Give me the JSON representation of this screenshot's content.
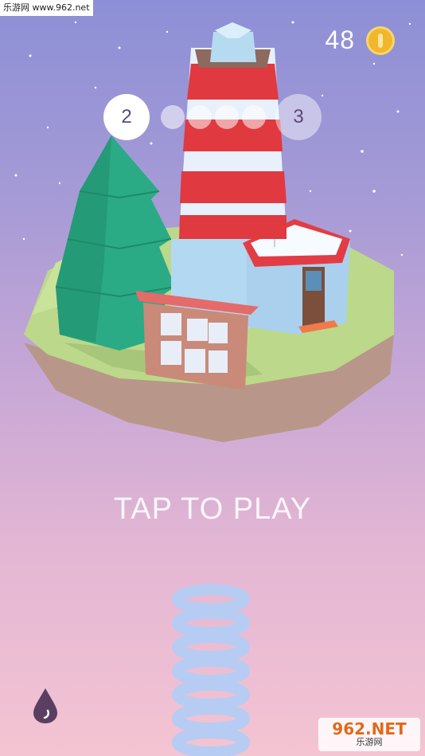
{
  "watermark": {
    "top": "乐游网 www.962.net",
    "logo": "962.NET",
    "sub": "乐游网"
  },
  "hud": {
    "coins": "48",
    "coin_icon": "coin-icon"
  },
  "progress": {
    "current_level": "2",
    "next_level": "3",
    "steps": 4
  },
  "main": {
    "prompt": "TAP TO PLAY"
  },
  "controls": {
    "drop_icon": "water-drop-icon"
  },
  "colors": {
    "lighthouse_red": "#e0393f",
    "lighthouse_white": "#e8f1fb",
    "tree_green": "#2bab85",
    "island_grass": "#b9d884",
    "spring": "#b7ccf2",
    "coin": "#f2b62c"
  }
}
